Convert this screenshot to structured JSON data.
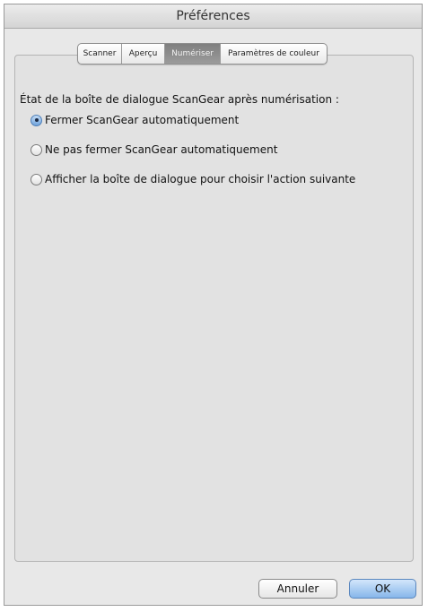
{
  "window": {
    "title": "Préférences"
  },
  "tabs": [
    {
      "label": "Scanner",
      "active": false
    },
    {
      "label": "Aperçu",
      "active": false
    },
    {
      "label": "Numériser",
      "active": true
    },
    {
      "label": "Paramètres de couleur",
      "active": false
    }
  ],
  "content": {
    "prompt": "État de la boîte de dialogue ScanGear après numérisation :",
    "options": [
      {
        "label": "Fermer ScanGear automatiquement",
        "selected": true
      },
      {
        "label": "Ne pas fermer ScanGear automatiquement",
        "selected": false
      },
      {
        "label": "Afficher la boîte de dialogue pour choisir l'action suivante",
        "selected": false
      }
    ]
  },
  "buttons": {
    "cancel": "Annuler",
    "ok": "OK"
  },
  "colors": {
    "accent": "#86b6ea",
    "active_tab": "#8a8a8a"
  }
}
